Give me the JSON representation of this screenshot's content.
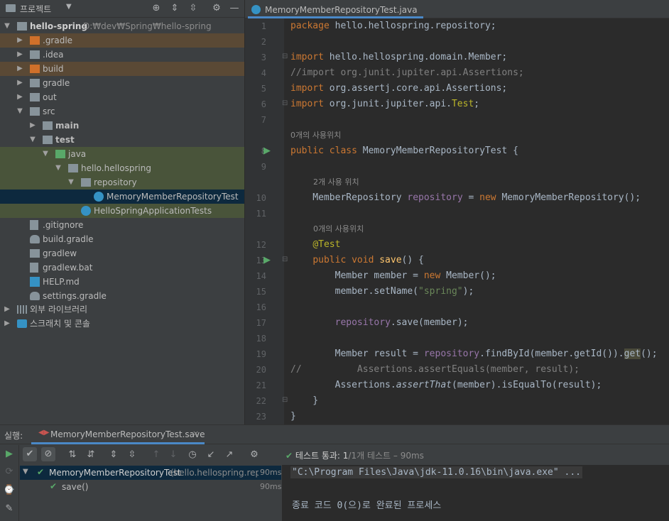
{
  "project_panel": {
    "title": "프로젝트",
    "root": {
      "name": "hello-spring",
      "path": "D:₩dev₩Spring₩hello-spring"
    },
    "items": [
      {
        "label": ".gradle"
      },
      {
        "label": ".idea"
      },
      {
        "label": "build"
      },
      {
        "label": "gradle"
      },
      {
        "label": "out"
      },
      {
        "label": "src"
      },
      {
        "label": "main"
      },
      {
        "label": "test"
      },
      {
        "label": "java"
      },
      {
        "label": "hello.hellospring"
      },
      {
        "label": "repository"
      },
      {
        "label": "MemoryMemberRepositoryTest"
      },
      {
        "label": "HelloSpringApplicationTests"
      },
      {
        "label": ".gitignore"
      },
      {
        "label": "build.gradle"
      },
      {
        "label": "gradlew"
      },
      {
        "label": "gradlew.bat"
      },
      {
        "label": "HELP.md"
      },
      {
        "label": "settings.gradle"
      },
      {
        "label": "외부 라이브러리"
      },
      {
        "label": "스크래치 및 콘솔"
      }
    ]
  },
  "editor": {
    "tab_label": "MemoryMemberRepositoryTest.java",
    "line_numbers": [
      "1",
      "2",
      "3",
      "4",
      "5",
      "6",
      "7",
      "8",
      "9",
      "10",
      "11",
      "12",
      "13",
      "14",
      "15",
      "16",
      "17",
      "18",
      "19",
      "20",
      "21",
      "22",
      "23"
    ],
    "hints": {
      "class_usage": "0개의 사용위치",
      "field_usage": "2개 사용 위치",
      "method_usage": "0개의 사용위치"
    }
  },
  "run_panel": {
    "label": "실행:",
    "config_tab": "MemoryMemberRepositoryTest.save",
    "status_prefix": "테스트 통과:",
    "status_count": "1",
    "status_suffix": "/1개 테스트 – 90ms",
    "results": [
      {
        "name": "MemoryMemberRepositoryTest",
        "package": "(hello.hellospring.repos",
        "time": "90ms"
      },
      {
        "name": "save()",
        "time": "90ms"
      }
    ],
    "console_lines": [
      "\"C:\\Program Files\\Java\\jdk-11.0.16\\bin\\java.exe\" ...",
      "종료 코드 0(으)로 완료된 프로세스"
    ]
  },
  "colors": {
    "accent": "#4a88c7",
    "pass_green": "#59a869",
    "keyword": "#cc7832",
    "string": "#6a8759",
    "field": "#9876aa",
    "annotation": "#bbb529"
  }
}
